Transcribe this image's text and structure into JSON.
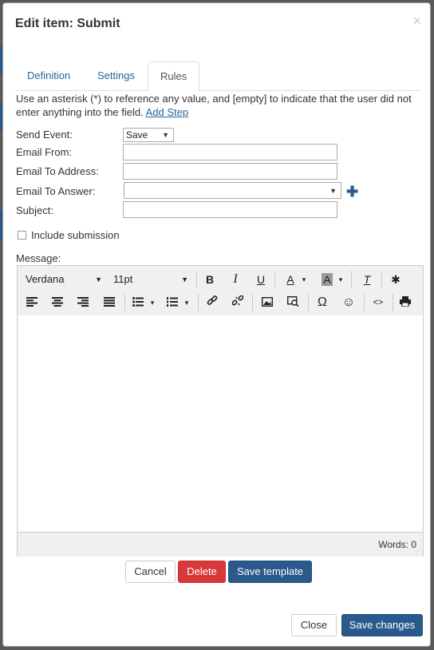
{
  "dialog": {
    "title": "Edit item: Submit",
    "close_glyph": "×"
  },
  "tabs": [
    {
      "label": "Definition",
      "active": false
    },
    {
      "label": "Settings",
      "active": false
    },
    {
      "label": "Rules",
      "active": true
    }
  ],
  "help": {
    "text": "Use an asterisk (*) to reference any value, and [empty] to indicate that the user did not enter anything into the field.",
    "link": "Add Step"
  },
  "form": {
    "send_event_label": "Send Event:",
    "send_event_value": "Save",
    "email_from_label": "Email From:",
    "email_from_value": "",
    "email_to_address_label": "Email To Address:",
    "email_to_address_value": "",
    "email_to_answer_label": "Email To Answer:",
    "email_to_answer_value": "",
    "subject_label": "Subject:",
    "subject_value": "",
    "include_submission_label": "Include submission",
    "include_submission_checked": false,
    "message_label": "Message:"
  },
  "editor": {
    "font_family": "Verdana",
    "font_size": "11pt",
    "glyphs": {
      "bold": "B",
      "italic": "I",
      "underline": "U",
      "text_color": "A",
      "bg_color": "A",
      "clear": "T",
      "special_char": "Ω",
      "emoji": "☺",
      "code": "<>",
      "dropdown": "▾",
      "accessibility": "✱",
      "link": "🔗",
      "image": "▣",
      "print": "⎙"
    },
    "word_count": "Words: 0",
    "grip": "⋰"
  },
  "footer": {
    "cancel": "Cancel",
    "delete": "Delete",
    "save_template": "Save template",
    "close": "Close",
    "save_changes": "Save changes"
  },
  "colors": {
    "primary": "#2a5a8c",
    "danger": "#d9383a",
    "link": "#2a6496"
  }
}
